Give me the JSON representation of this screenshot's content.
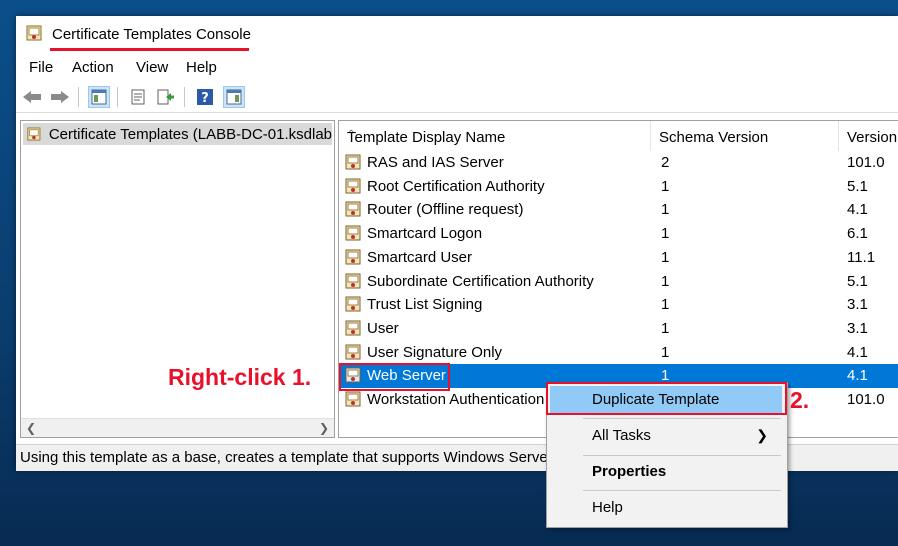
{
  "window": {
    "title": "Certificate Templates Console"
  },
  "menu": [
    "File",
    "Action",
    "View",
    "Help"
  ],
  "toolbar": {
    "icons": [
      "back-arrow-icon",
      "forward-arrow-icon",
      "show-hide-tree-icon",
      "properties-icon",
      "export-list-icon",
      "help-icon",
      "action-pane-icon"
    ]
  },
  "tree": {
    "root_label": "Certificate Templates (LABB-DC-01.ksdlab"
  },
  "list": {
    "columns": [
      "Template Display Name",
      "Schema Version",
      "Version"
    ],
    "rows": [
      {
        "name": "RAS and IAS Server",
        "schema": "2",
        "version": "101.0"
      },
      {
        "name": "Root Certification Authority",
        "schema": "1",
        "version": "5.1"
      },
      {
        "name": "Router (Offline request)",
        "schema": "1",
        "version": "4.1"
      },
      {
        "name": "Smartcard Logon",
        "schema": "1",
        "version": "6.1"
      },
      {
        "name": "Smartcard User",
        "schema": "1",
        "version": "11.1"
      },
      {
        "name": "Subordinate Certification Authority",
        "schema": "1",
        "version": "5.1"
      },
      {
        "name": "Trust List Signing",
        "schema": "1",
        "version": "3.1"
      },
      {
        "name": "User",
        "schema": "1",
        "version": "3.1"
      },
      {
        "name": "User Signature Only",
        "schema": "1",
        "version": "4.1"
      },
      {
        "name": "Web Server",
        "schema": "1",
        "version": "4.1"
      },
      {
        "name": "Workstation Authentication",
        "schema": "",
        "version": "101.0"
      }
    ]
  },
  "status": "Using this template as a base, creates a template that supports Windows Server 2",
  "context_menu": {
    "duplicate": "Duplicate Template",
    "all_tasks": "All Tasks",
    "properties": "Properties",
    "help": "Help"
  },
  "annotations": {
    "step1": "Right-click  1.",
    "step2": "2."
  },
  "colors": {
    "accent_red": "#e8102a",
    "selection": "#0078d7",
    "menu_highlight": "#91c9f7"
  }
}
